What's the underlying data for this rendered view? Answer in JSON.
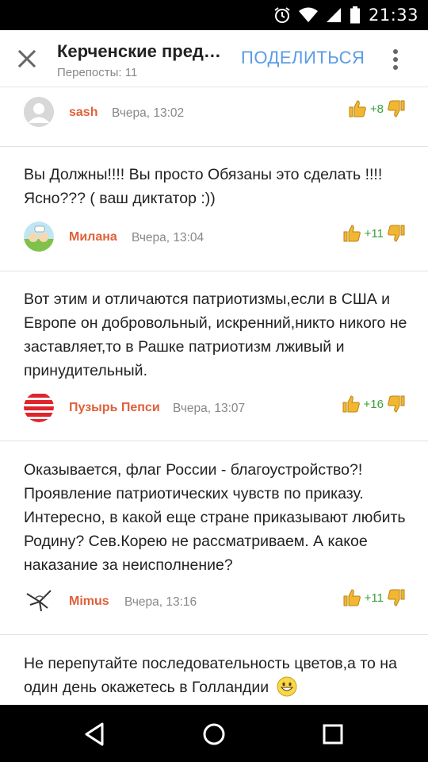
{
  "status_bar": {
    "time": "21:33"
  },
  "app_bar": {
    "title": "Керченские пред…",
    "subtitle": "Перепосты: 11",
    "share_label": "ПОДЕЛИТЬСЯ"
  },
  "comments": [
    {
      "text": "",
      "author": "sash",
      "time": "Вчера, 13:02",
      "votes": "+8",
      "avatar_icon": "default-user-icon"
    },
    {
      "text": "Вы Должны!!!! Вы просто Обязаны это сделать !!!! Ясно??? ( ваш диктатор :))",
      "author": "Милана",
      "time": "Вчера, 13:04",
      "votes": "+11",
      "avatar_icon": "cartoon-avatar"
    },
    {
      "text": "Вот этим и отличаются патриотизмы,если в США и Европе он добровольный, искренний,никто никого не заставляет,то в Рашке патриотизм лживый и принудительный.",
      "author": "Пузырь Пепси",
      "time": "Вчера, 13:07",
      "votes": "+16",
      "avatar_icon": "striped-ball-avatar"
    },
    {
      "text": "Оказывается, флаг России - благоустройство?! Проявление патриотических чувств по приказу. Интересно, в какой еще стране приказывают любить Родину? Сев.Корею не рассматриваем. А какое наказание за неисполнение?",
      "author": "Mimus",
      "time": "Вчера, 13:16",
      "votes": "+11",
      "avatar_icon": "bird-sketch-avatar"
    },
    {
      "text": "Не перепутайте последовательность цветов,а то на один день окажетесь в Голландии",
      "emoji": "grinning-face-emoji"
    }
  ],
  "colors": {
    "accent": "#5a9be6",
    "author": "#e0603a",
    "positive": "#3aa13a",
    "thumb": "#f2b631"
  }
}
